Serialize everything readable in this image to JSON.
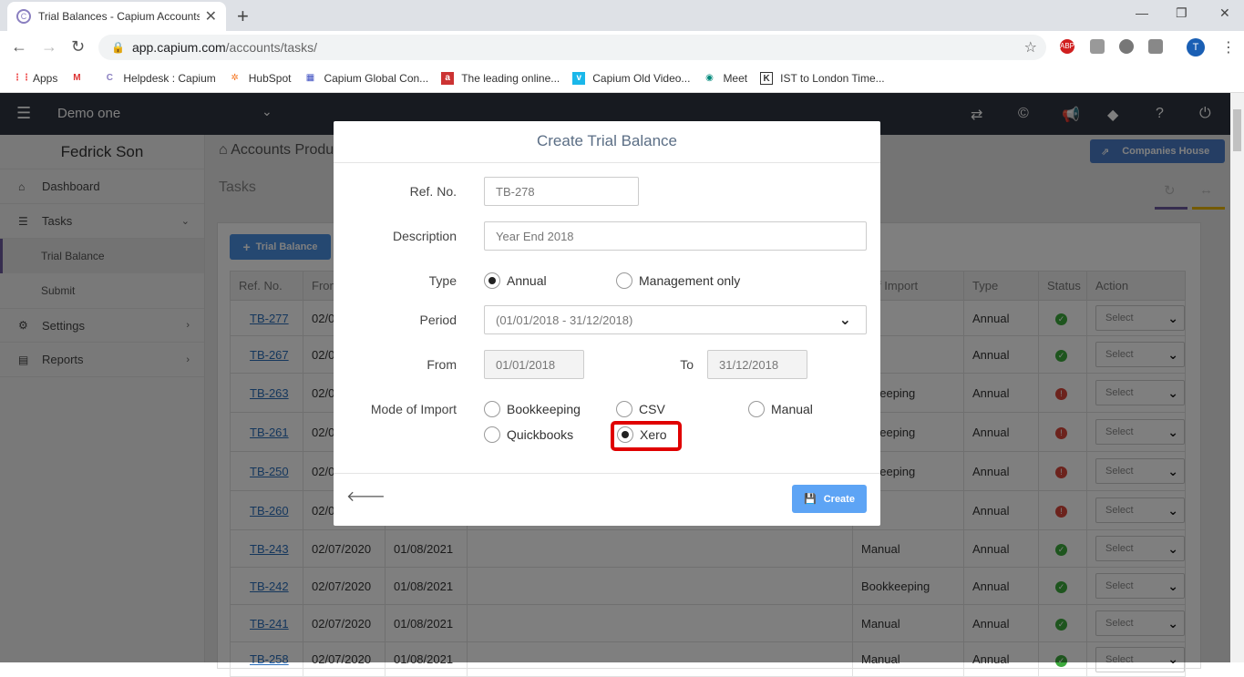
{
  "browser": {
    "tab_title": "Trial Balances - Capium Accounts",
    "url_host": "app.capium.com",
    "url_path": "/accounts/tasks/",
    "profile_initial": "T",
    "bookmarks": [
      "Apps",
      "Helpdesk : Capium",
      "HubSpot",
      "Capium Global Con...",
      "The leading online...",
      "Capium Old Video...",
      "Meet",
      "IST to London Time..."
    ]
  },
  "app": {
    "org_name": "Demo one",
    "user_name": "Fedrick Son",
    "sidebar": {
      "dashboard": "Dashboard",
      "tasks": "Tasks",
      "trial_balance": "Trial Balance",
      "submit": "Submit",
      "settings": "Settings",
      "reports": "Reports"
    },
    "breadcrumb": "Accounts Produ",
    "page_title": "Tasks",
    "companies_house": "Companies House",
    "trial_balance_btn": "Trial Balance"
  },
  "table": {
    "headers": [
      "Ref. No.",
      "From",
      "",
      "",
      "e of Import",
      "Type",
      "Status",
      "Action"
    ],
    "select_label": "Select",
    "rows": [
      {
        "ref": "TB-277",
        "from": "02/0",
        "to": "",
        "mode": "ual",
        "type": "Annual",
        "status": "ok"
      },
      {
        "ref": "TB-267",
        "from": "02/0",
        "to": "",
        "mode": "ual",
        "type": "Annual",
        "status": "ok"
      },
      {
        "ref": "TB-263",
        "from": "02/0",
        "to": "",
        "mode": "okkeeping",
        "type": "Annual",
        "status": "err"
      },
      {
        "ref": "TB-261",
        "from": "02/0",
        "to": "",
        "mode": "okkeeping",
        "type": "Annual",
        "status": "err"
      },
      {
        "ref": "TB-250",
        "from": "02/0",
        "to": "",
        "mode": "okkeeping",
        "type": "Annual",
        "status": "err"
      },
      {
        "ref": "TB-260",
        "from": "02/0",
        "to": "",
        "mode": "ual",
        "type": "Annual",
        "status": "err"
      },
      {
        "ref": "TB-243",
        "from": "02/07/2020",
        "to": "01/08/2021",
        "mode": "Manual",
        "type": "Annual",
        "status": "ok"
      },
      {
        "ref": "TB-242",
        "from": "02/07/2020",
        "to": "01/08/2021",
        "mode": "Bookkeeping",
        "type": "Annual",
        "status": "ok"
      },
      {
        "ref": "TB-241",
        "from": "02/07/2020",
        "to": "01/08/2021",
        "mode": "Manual",
        "type": "Annual",
        "status": "ok"
      },
      {
        "ref": "TB-258",
        "from": "02/07/2020",
        "to": "01/08/2021",
        "mode": "Manual",
        "type": "Annual",
        "status": "ok"
      }
    ]
  },
  "modal": {
    "title": "Create Trial Balance",
    "ref_label": "Ref. No.",
    "ref_value": "TB-278",
    "desc_label": "Description",
    "desc_value": "Year End 2018",
    "type_label": "Type",
    "type_annual": "Annual",
    "type_mgmt": "Management only",
    "period_label": "Period",
    "period_value": "(01/01/2018 - 31/12/2018)",
    "from_label": "From",
    "from_value": "01/01/2018",
    "to_label": "To",
    "to_value": "31/12/2018",
    "mode_label": "Mode of Import",
    "modes": {
      "bookkeeping": "Bookkeeping",
      "csv": "CSV",
      "manual": "Manual",
      "quickbooks": "Quickbooks",
      "xero": "Xero"
    },
    "create_label": "Create"
  }
}
